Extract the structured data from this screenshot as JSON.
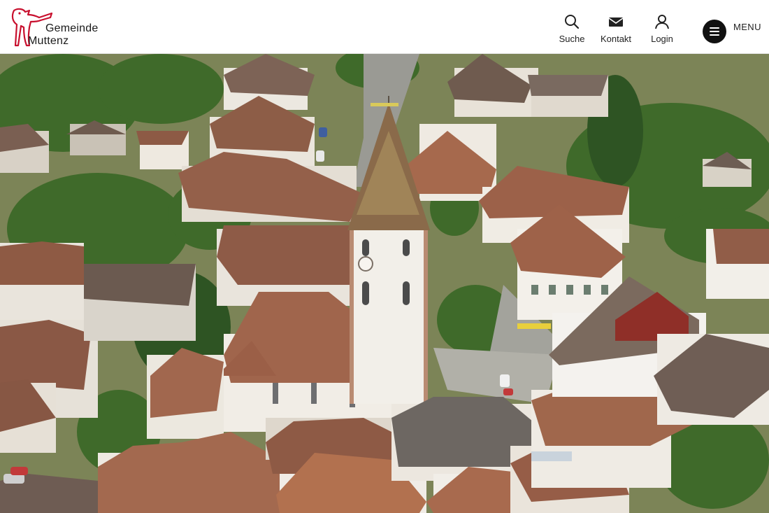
{
  "logo": {
    "line1": "Gemeinde",
    "line2": "Muttenz",
    "mark_icon": "coat-of-arms-icon",
    "mark_color": "#c8102e"
  },
  "nav": {
    "search": {
      "label": "Suche",
      "icon": "search-icon"
    },
    "contact": {
      "label": "Kontakt",
      "icon": "envelope-icon"
    },
    "login": {
      "label": "Login",
      "icon": "user-icon"
    },
    "menu": {
      "label": "MENU",
      "icon": "hamburger-icon"
    }
  },
  "hero": {
    "subject": "aerial photo"
  },
  "colors": {
    "header_bg": "#ffffff",
    "menu_button_bg": "#111111",
    "brand_red": "#c8102e"
  }
}
